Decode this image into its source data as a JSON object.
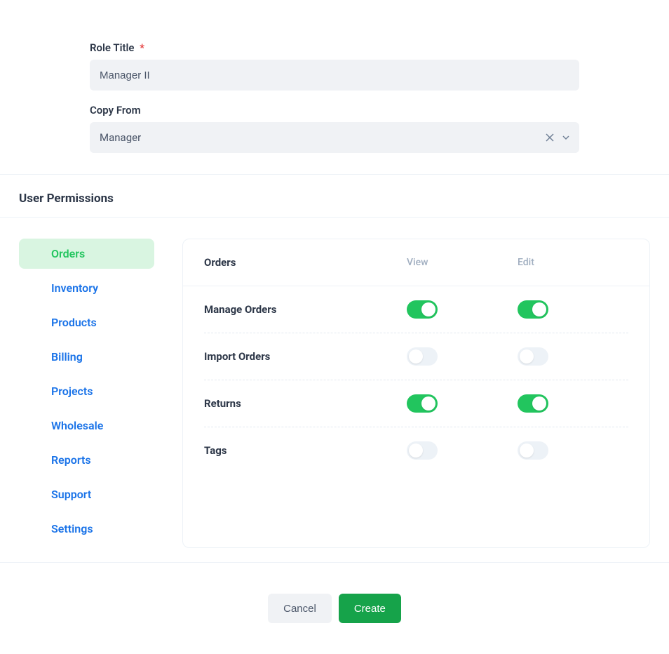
{
  "form": {
    "role_title_label": "Role Title",
    "role_title_value": "Manager II",
    "copy_from_label": "Copy From",
    "copy_from_value": "Manager"
  },
  "section": {
    "title": "User Permissions"
  },
  "nav": {
    "items": [
      {
        "label": "Orders",
        "active": true
      },
      {
        "label": "Inventory",
        "active": false
      },
      {
        "label": "Products",
        "active": false
      },
      {
        "label": "Billing",
        "active": false
      },
      {
        "label": "Projects",
        "active": false
      },
      {
        "label": "Wholesale",
        "active": false
      },
      {
        "label": "Reports",
        "active": false
      },
      {
        "label": "Support",
        "active": false
      },
      {
        "label": "Settings",
        "active": false
      }
    ]
  },
  "permissions": {
    "panel_title": "Orders",
    "col_view": "View",
    "col_edit": "Edit",
    "rows": [
      {
        "label": "Manage Orders",
        "view": true,
        "edit": true
      },
      {
        "label": "Import Orders",
        "view": false,
        "edit": false
      },
      {
        "label": "Returns",
        "view": true,
        "edit": true
      },
      {
        "label": "Tags",
        "view": false,
        "edit": false
      }
    ]
  },
  "footer": {
    "cancel": "Cancel",
    "create": "Create"
  }
}
